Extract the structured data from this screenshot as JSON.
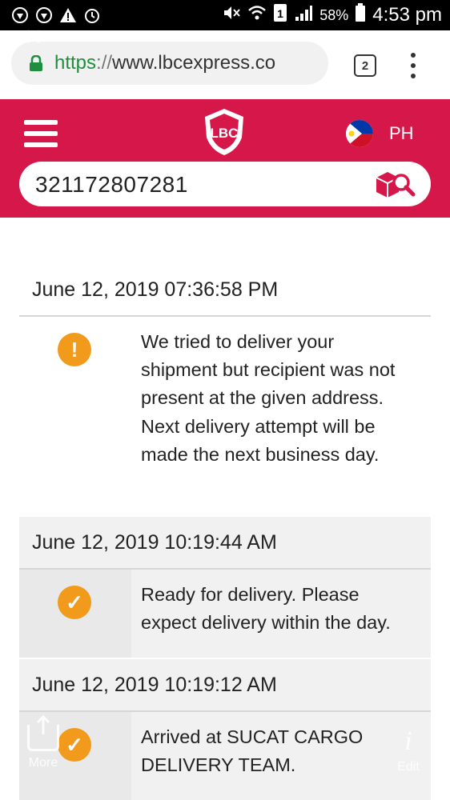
{
  "status_bar": {
    "battery_percent": "58%",
    "time": "4:53 pm",
    "icons": [
      "bug-icon",
      "bug-icon",
      "warning-icon",
      "alarm-icon",
      "mute-icon",
      "wifi-icon",
      "sim-icon",
      "signal-icon",
      "battery-icon"
    ]
  },
  "browser": {
    "url_scheme": "https",
    "url_sep": "://",
    "url_host": "www.lbcexpress.co",
    "tab_count": "2"
  },
  "header": {
    "logo_text": "LBC",
    "country": "PH",
    "search_value": "321172807281",
    "brand_color": "#d5174a"
  },
  "events": [
    {
      "date": "June 12, 2019 07:36:58 PM",
      "icon": "exclamation-icon",
      "icon_glyph": "!",
      "message": "We tried to deliver your shipment but recipient was not present at the given address. Next delivery attempt will be made the next business day."
    },
    {
      "date": "June 12, 2019 10:19:44 AM",
      "icon": "check-icon",
      "icon_glyph": "✓",
      "message": "Ready for delivery. Please expect delivery within the day."
    },
    {
      "date": "June 12, 2019 10:19:12 AM",
      "icon": "check-icon",
      "icon_glyph": "✓",
      "message": "Arrived at SUCAT CARGO DELIVERY TEAM."
    }
  ],
  "overlay": {
    "more_label": "More",
    "edit_label": "Edit"
  },
  "accent_color": "#f19a1b"
}
